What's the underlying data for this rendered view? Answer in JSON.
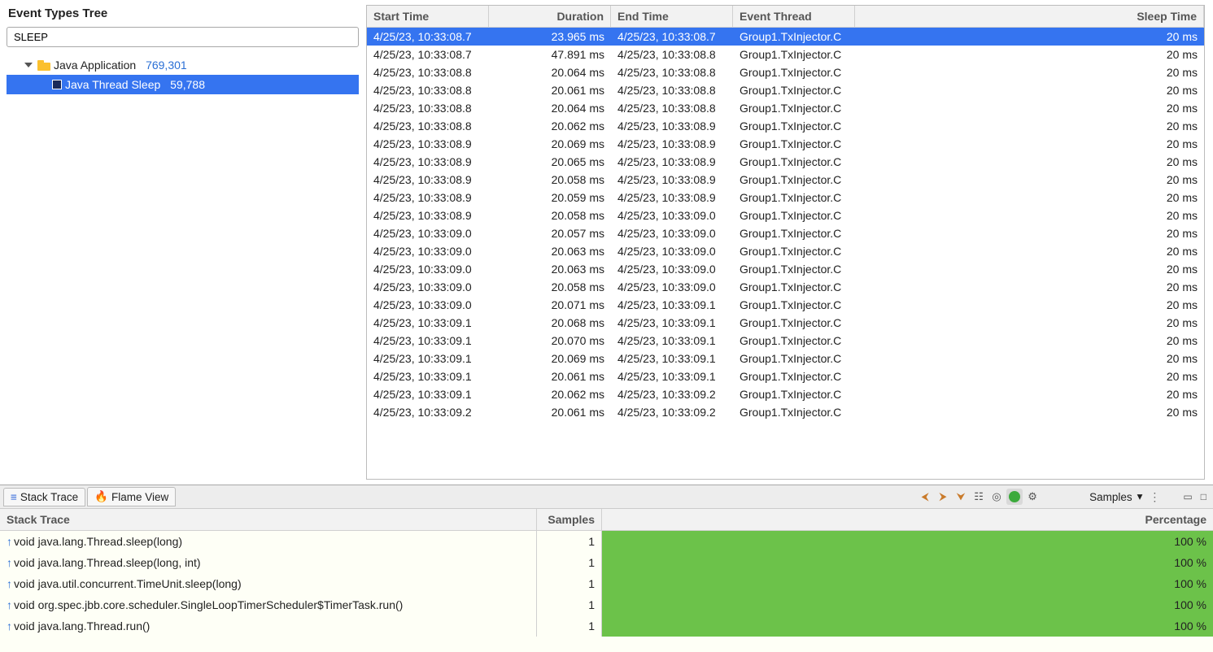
{
  "left": {
    "title": "Event Types Tree",
    "search_value": "SLEEP",
    "root_label": "Java Application",
    "root_count": "769,301",
    "child_label": "Java Thread Sleep",
    "child_count": "59,788"
  },
  "columns": [
    "Start Time",
    "Duration",
    "End Time",
    "Event Thread",
    "Sleep Time"
  ],
  "rows": [
    {
      "sel": true,
      "start": "4/25/23, 10:33:08.7",
      "dur": "23.965 ms",
      "end": "4/25/23, 10:33:08.7",
      "thr": "Group1.TxInjector.C",
      "sleep": "20 ms"
    },
    {
      "start": "4/25/23, 10:33:08.7",
      "dur": "47.891 ms",
      "end": "4/25/23, 10:33:08.8",
      "thr": "Group1.TxInjector.C",
      "sleep": "20 ms"
    },
    {
      "start": "4/25/23, 10:33:08.8",
      "dur": "20.064 ms",
      "end": "4/25/23, 10:33:08.8",
      "thr": "Group1.TxInjector.C",
      "sleep": "20 ms"
    },
    {
      "start": "4/25/23, 10:33:08.8",
      "dur": "20.061 ms",
      "end": "4/25/23, 10:33:08.8",
      "thr": "Group1.TxInjector.C",
      "sleep": "20 ms"
    },
    {
      "start": "4/25/23, 10:33:08.8",
      "dur": "20.064 ms",
      "end": "4/25/23, 10:33:08.8",
      "thr": "Group1.TxInjector.C",
      "sleep": "20 ms"
    },
    {
      "start": "4/25/23, 10:33:08.8",
      "dur": "20.062 ms",
      "end": "4/25/23, 10:33:08.9",
      "thr": "Group1.TxInjector.C",
      "sleep": "20 ms"
    },
    {
      "start": "4/25/23, 10:33:08.9",
      "dur": "20.069 ms",
      "end": "4/25/23, 10:33:08.9",
      "thr": "Group1.TxInjector.C",
      "sleep": "20 ms"
    },
    {
      "start": "4/25/23, 10:33:08.9",
      "dur": "20.065 ms",
      "end": "4/25/23, 10:33:08.9",
      "thr": "Group1.TxInjector.C",
      "sleep": "20 ms"
    },
    {
      "start": "4/25/23, 10:33:08.9",
      "dur": "20.058 ms",
      "end": "4/25/23, 10:33:08.9",
      "thr": "Group1.TxInjector.C",
      "sleep": "20 ms"
    },
    {
      "start": "4/25/23, 10:33:08.9",
      "dur": "20.059 ms",
      "end": "4/25/23, 10:33:08.9",
      "thr": "Group1.TxInjector.C",
      "sleep": "20 ms"
    },
    {
      "start": "4/25/23, 10:33:08.9",
      "dur": "20.058 ms",
      "end": "4/25/23, 10:33:09.0",
      "thr": "Group1.TxInjector.C",
      "sleep": "20 ms"
    },
    {
      "start": "4/25/23, 10:33:09.0",
      "dur": "20.057 ms",
      "end": "4/25/23, 10:33:09.0",
      "thr": "Group1.TxInjector.C",
      "sleep": "20 ms"
    },
    {
      "start": "4/25/23, 10:33:09.0",
      "dur": "20.063 ms",
      "end": "4/25/23, 10:33:09.0",
      "thr": "Group1.TxInjector.C",
      "sleep": "20 ms"
    },
    {
      "start": "4/25/23, 10:33:09.0",
      "dur": "20.063 ms",
      "end": "4/25/23, 10:33:09.0",
      "thr": "Group1.TxInjector.C",
      "sleep": "20 ms"
    },
    {
      "start": "4/25/23, 10:33:09.0",
      "dur": "20.058 ms",
      "end": "4/25/23, 10:33:09.0",
      "thr": "Group1.TxInjector.C",
      "sleep": "20 ms"
    },
    {
      "start": "4/25/23, 10:33:09.0",
      "dur": "20.071 ms",
      "end": "4/25/23, 10:33:09.1",
      "thr": "Group1.TxInjector.C",
      "sleep": "20 ms"
    },
    {
      "start": "4/25/23, 10:33:09.1",
      "dur": "20.068 ms",
      "end": "4/25/23, 10:33:09.1",
      "thr": "Group1.TxInjector.C",
      "sleep": "20 ms"
    },
    {
      "start": "4/25/23, 10:33:09.1",
      "dur": "20.070 ms",
      "end": "4/25/23, 10:33:09.1",
      "thr": "Group1.TxInjector.C",
      "sleep": "20 ms"
    },
    {
      "start": "4/25/23, 10:33:09.1",
      "dur": "20.069 ms",
      "end": "4/25/23, 10:33:09.1",
      "thr": "Group1.TxInjector.C",
      "sleep": "20 ms"
    },
    {
      "start": "4/25/23, 10:33:09.1",
      "dur": "20.061 ms",
      "end": "4/25/23, 10:33:09.1",
      "thr": "Group1.TxInjector.C",
      "sleep": "20 ms"
    },
    {
      "start": "4/25/23, 10:33:09.1",
      "dur": "20.062 ms",
      "end": "4/25/23, 10:33:09.2",
      "thr": "Group1.TxInjector.C",
      "sleep": "20 ms"
    },
    {
      "start": "4/25/23, 10:33:09.2",
      "dur": "20.061 ms",
      "end": "4/25/23, 10:33:09.2",
      "thr": "Group1.TxInjector.C",
      "sleep": "20 ms"
    }
  ],
  "tabs": {
    "stack": "Stack Trace",
    "flame": "Flame View",
    "samples_label": "Samples"
  },
  "stack_columns": [
    "Stack Trace",
    "Samples",
    "Percentage"
  ],
  "stack_rows": [
    {
      "m": "void java.lang.Thread.sleep(long)",
      "s": "1",
      "p": "100 %"
    },
    {
      "m": "void java.lang.Thread.sleep(long, int)",
      "s": "1",
      "p": "100 %"
    },
    {
      "m": "void java.util.concurrent.TimeUnit.sleep(long)",
      "s": "1",
      "p": "100 %"
    },
    {
      "m": "void org.spec.jbb.core.scheduler.SingleLoopTimerScheduler$TimerTask.run()",
      "s": "1",
      "p": "100 %"
    },
    {
      "m": "void java.lang.Thread.run()",
      "s": "1",
      "p": "100 %"
    }
  ]
}
